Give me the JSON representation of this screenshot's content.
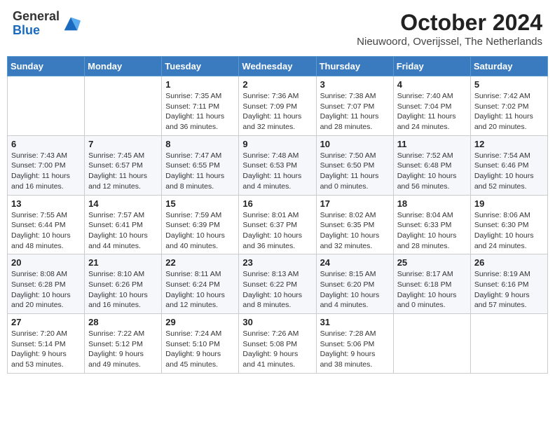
{
  "header": {
    "logo_general": "General",
    "logo_blue": "Blue",
    "title": "October 2024",
    "subtitle": "Nieuwoord, Overijssel, The Netherlands"
  },
  "days_of_week": [
    "Sunday",
    "Monday",
    "Tuesday",
    "Wednesday",
    "Thursday",
    "Friday",
    "Saturday"
  ],
  "weeks": [
    [
      {
        "day": "",
        "detail": ""
      },
      {
        "day": "",
        "detail": ""
      },
      {
        "day": "1",
        "detail": "Sunrise: 7:35 AM\nSunset: 7:11 PM\nDaylight: 11 hours and 36 minutes."
      },
      {
        "day": "2",
        "detail": "Sunrise: 7:36 AM\nSunset: 7:09 PM\nDaylight: 11 hours and 32 minutes."
      },
      {
        "day": "3",
        "detail": "Sunrise: 7:38 AM\nSunset: 7:07 PM\nDaylight: 11 hours and 28 minutes."
      },
      {
        "day": "4",
        "detail": "Sunrise: 7:40 AM\nSunset: 7:04 PM\nDaylight: 11 hours and 24 minutes."
      },
      {
        "day": "5",
        "detail": "Sunrise: 7:42 AM\nSunset: 7:02 PM\nDaylight: 11 hours and 20 minutes."
      }
    ],
    [
      {
        "day": "6",
        "detail": "Sunrise: 7:43 AM\nSunset: 7:00 PM\nDaylight: 11 hours and 16 minutes."
      },
      {
        "day": "7",
        "detail": "Sunrise: 7:45 AM\nSunset: 6:57 PM\nDaylight: 11 hours and 12 minutes."
      },
      {
        "day": "8",
        "detail": "Sunrise: 7:47 AM\nSunset: 6:55 PM\nDaylight: 11 hours and 8 minutes."
      },
      {
        "day": "9",
        "detail": "Sunrise: 7:48 AM\nSunset: 6:53 PM\nDaylight: 11 hours and 4 minutes."
      },
      {
        "day": "10",
        "detail": "Sunrise: 7:50 AM\nSunset: 6:50 PM\nDaylight: 11 hours and 0 minutes."
      },
      {
        "day": "11",
        "detail": "Sunrise: 7:52 AM\nSunset: 6:48 PM\nDaylight: 10 hours and 56 minutes."
      },
      {
        "day": "12",
        "detail": "Sunrise: 7:54 AM\nSunset: 6:46 PM\nDaylight: 10 hours and 52 minutes."
      }
    ],
    [
      {
        "day": "13",
        "detail": "Sunrise: 7:55 AM\nSunset: 6:44 PM\nDaylight: 10 hours and 48 minutes."
      },
      {
        "day": "14",
        "detail": "Sunrise: 7:57 AM\nSunset: 6:41 PM\nDaylight: 10 hours and 44 minutes."
      },
      {
        "day": "15",
        "detail": "Sunrise: 7:59 AM\nSunset: 6:39 PM\nDaylight: 10 hours and 40 minutes."
      },
      {
        "day": "16",
        "detail": "Sunrise: 8:01 AM\nSunset: 6:37 PM\nDaylight: 10 hours and 36 minutes."
      },
      {
        "day": "17",
        "detail": "Sunrise: 8:02 AM\nSunset: 6:35 PM\nDaylight: 10 hours and 32 minutes."
      },
      {
        "day": "18",
        "detail": "Sunrise: 8:04 AM\nSunset: 6:33 PM\nDaylight: 10 hours and 28 minutes."
      },
      {
        "day": "19",
        "detail": "Sunrise: 8:06 AM\nSunset: 6:30 PM\nDaylight: 10 hours and 24 minutes."
      }
    ],
    [
      {
        "day": "20",
        "detail": "Sunrise: 8:08 AM\nSunset: 6:28 PM\nDaylight: 10 hours and 20 minutes."
      },
      {
        "day": "21",
        "detail": "Sunrise: 8:10 AM\nSunset: 6:26 PM\nDaylight: 10 hours and 16 minutes."
      },
      {
        "day": "22",
        "detail": "Sunrise: 8:11 AM\nSunset: 6:24 PM\nDaylight: 10 hours and 12 minutes."
      },
      {
        "day": "23",
        "detail": "Sunrise: 8:13 AM\nSunset: 6:22 PM\nDaylight: 10 hours and 8 minutes."
      },
      {
        "day": "24",
        "detail": "Sunrise: 8:15 AM\nSunset: 6:20 PM\nDaylight: 10 hours and 4 minutes."
      },
      {
        "day": "25",
        "detail": "Sunrise: 8:17 AM\nSunset: 6:18 PM\nDaylight: 10 hours and 0 minutes."
      },
      {
        "day": "26",
        "detail": "Sunrise: 8:19 AM\nSunset: 6:16 PM\nDaylight: 9 hours and 57 minutes."
      }
    ],
    [
      {
        "day": "27",
        "detail": "Sunrise: 7:20 AM\nSunset: 5:14 PM\nDaylight: 9 hours and 53 minutes."
      },
      {
        "day": "28",
        "detail": "Sunrise: 7:22 AM\nSunset: 5:12 PM\nDaylight: 9 hours and 49 minutes."
      },
      {
        "day": "29",
        "detail": "Sunrise: 7:24 AM\nSunset: 5:10 PM\nDaylight: 9 hours and 45 minutes."
      },
      {
        "day": "30",
        "detail": "Sunrise: 7:26 AM\nSunset: 5:08 PM\nDaylight: 9 hours and 41 minutes."
      },
      {
        "day": "31",
        "detail": "Sunrise: 7:28 AM\nSunset: 5:06 PM\nDaylight: 9 hours and 38 minutes."
      },
      {
        "day": "",
        "detail": ""
      },
      {
        "day": "",
        "detail": ""
      }
    ]
  ]
}
